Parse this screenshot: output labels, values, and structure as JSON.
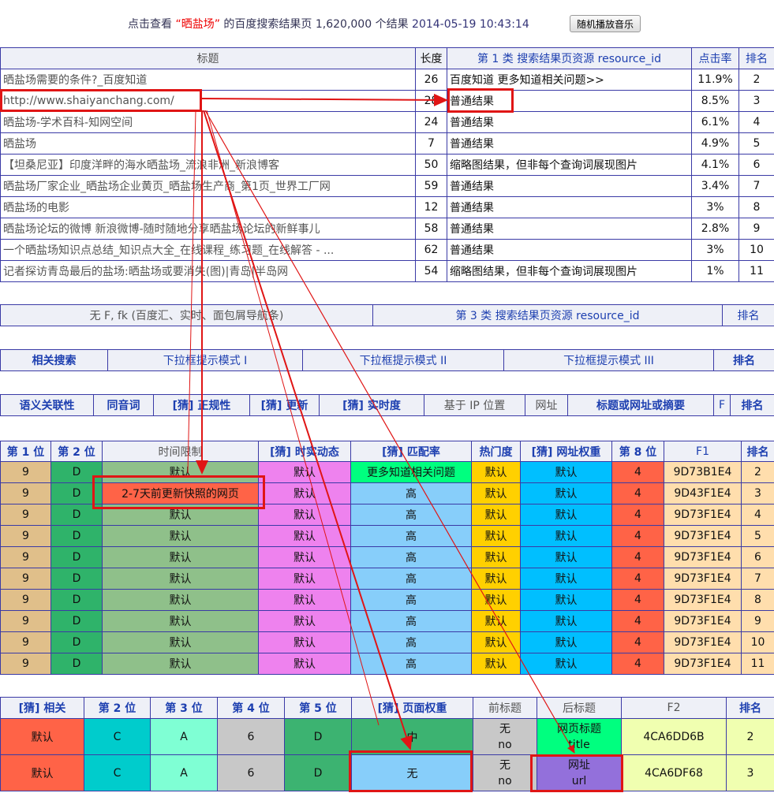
{
  "topbar": {
    "prefix": "点击查看",
    "keyword": "“晒盐场”",
    "middle": "的百度搜索结果页 1,620,000 个结果",
    "datetime": "2014-05-19 10:43:14",
    "music_button": "随机播放音乐"
  },
  "results": {
    "headers": [
      "标题",
      "长度",
      "第 1 类  搜索结果页资源 resource_id",
      "点击率",
      "排名"
    ],
    "rows": [
      {
        "title": "晒盐场需要的条件?_百度知道",
        "length": "26",
        "type": "百度知道 更多知道相关问题>>",
        "ctr": "11.9%",
        "rank": "2"
      },
      {
        "title": "http://www.shaiyanchang.com/",
        "length": "28",
        "type": "普通结果",
        "ctr": "8.5%",
        "rank": "3"
      },
      {
        "title": "晒盐场-学术百科-知网空间",
        "length": "24",
        "type": "普通结果",
        "ctr": "6.1%",
        "rank": "4"
      },
      {
        "title": "晒盐场",
        "length": "7",
        "type": "普通结果",
        "ctr": "4.9%",
        "rank": "5"
      },
      {
        "title": "【坦桑尼亚】印度洋畔的海水晒盐场_流浪非洲_新浪博客",
        "length": "50",
        "type": "缩略图结果，但非每个查询词展现图片",
        "ctr": "4.1%",
        "rank": "6"
      },
      {
        "title": "晒盐场厂家企业_晒盐场企业黄页_晒盐场生产商_第1页_世界工厂网",
        "length": "59",
        "type": "普通结果",
        "ctr": "3.4%",
        "rank": "7"
      },
      {
        "title": "晒盐场的电影",
        "length": "12",
        "type": "普通结果",
        "ctr": "3%",
        "rank": "8"
      },
      {
        "title": "晒盐场论坛的微博 新浪微博-随时随地分享晒盐场论坛的新鲜事儿",
        "length": "58",
        "type": "普通结果",
        "ctr": "2.8%",
        "rank": "9"
      },
      {
        "title": "一个晒盐场知识点总结_知识点大全_在线课程_练习题_在线解答 - ...",
        "length": "62",
        "type": "普通结果",
        "ctr": "3%",
        "rank": "10"
      },
      {
        "title": "记者探访青岛最后的盐场:晒盐场或要消失(图)|青岛|半岛网",
        "length": "54",
        "type": "缩略图结果，但非每个查询词展现图片",
        "ctr": "1%",
        "rank": "11"
      }
    ]
  },
  "bar2": {
    "col1": "无 F, fk (百度汇、实时、面包屑导航条)",
    "col2": "第 3 类 搜索结果页资源 resource_id",
    "col3": "排名"
  },
  "bar3": {
    "cols": [
      "相关搜索",
      "下拉框提示模式 I",
      "下拉框提示模式 II",
      "下拉框提示模式 III",
      "排名"
    ]
  },
  "bar4": {
    "cols": [
      "语义关联性",
      "同音词",
      "[猜] 正规性",
      "[猜] 更新",
      "[猜] 实时度",
      "基于 IP 位置",
      "网址",
      "标题或网址或摘要",
      "F",
      "排名"
    ]
  },
  "grid1": {
    "headers": [
      "第 1 位",
      "第 2 位",
      "时间限制",
      "[猜] 时实动态",
      "[猜] 匹配率",
      "热门度",
      "[猜] 网址权重",
      "第 8 位",
      "F1",
      "排名"
    ],
    "rows": [
      [
        "9",
        "D",
        "默认",
        "默认",
        "更多知道相关问题",
        "默认",
        "默认",
        "4",
        "9D73B1E4",
        "2"
      ],
      [
        "9",
        "D",
        "2-7天前更新快照的网页",
        "默认",
        "高",
        "默认",
        "默认",
        "4",
        "9D43F1E4",
        "3"
      ],
      [
        "9",
        "D",
        "默认",
        "默认",
        "高",
        "默认",
        "默认",
        "4",
        "9D73F1E4",
        "4"
      ],
      [
        "9",
        "D",
        "默认",
        "默认",
        "高",
        "默认",
        "默认",
        "4",
        "9D73F1E4",
        "5"
      ],
      [
        "9",
        "D",
        "默认",
        "默认",
        "高",
        "默认",
        "默认",
        "4",
        "9D73F1E4",
        "6"
      ],
      [
        "9",
        "D",
        "默认",
        "默认",
        "高",
        "默认",
        "默认",
        "4",
        "9D73F1E4",
        "7"
      ],
      [
        "9",
        "D",
        "默认",
        "默认",
        "高",
        "默认",
        "默认",
        "4",
        "9D73F1E4",
        "8"
      ],
      [
        "9",
        "D",
        "默认",
        "默认",
        "高",
        "默认",
        "默认",
        "4",
        "9D73F1E4",
        "9"
      ],
      [
        "9",
        "D",
        "默认",
        "默认",
        "高",
        "默认",
        "默认",
        "4",
        "9D73F1E4",
        "10"
      ],
      [
        "9",
        "D",
        "默认",
        "默认",
        "高",
        "默认",
        "默认",
        "4",
        "9D73F1E4",
        "11"
      ]
    ]
  },
  "grid2": {
    "headers": [
      "[猜] 相关",
      "第 2 位",
      "第 3 位",
      "第 4 位",
      "第 5 位",
      "[猜] 页面权重",
      "前标题",
      "后标题",
      "F2",
      "排名"
    ],
    "rows": [
      {
        "cells": [
          "默认",
          "C",
          "A",
          "6",
          "D",
          "中"
        ],
        "pre": [
          "无",
          "no"
        ],
        "post": [
          "网页标题",
          "title"
        ],
        "f2": "4CA6DD6B",
        "rank": "2"
      },
      {
        "cells": [
          "默认",
          "C",
          "A",
          "6",
          "D",
          "无"
        ],
        "pre": [
          "无",
          "no"
        ],
        "post": [
          "网址",
          "url"
        ],
        "f2": "4CA6DF68",
        "rank": "3"
      }
    ]
  },
  "colors": {
    "border": "#3a3aa6",
    "highlight_red": "#e01515",
    "link_blue": "#1d3fb0"
  }
}
